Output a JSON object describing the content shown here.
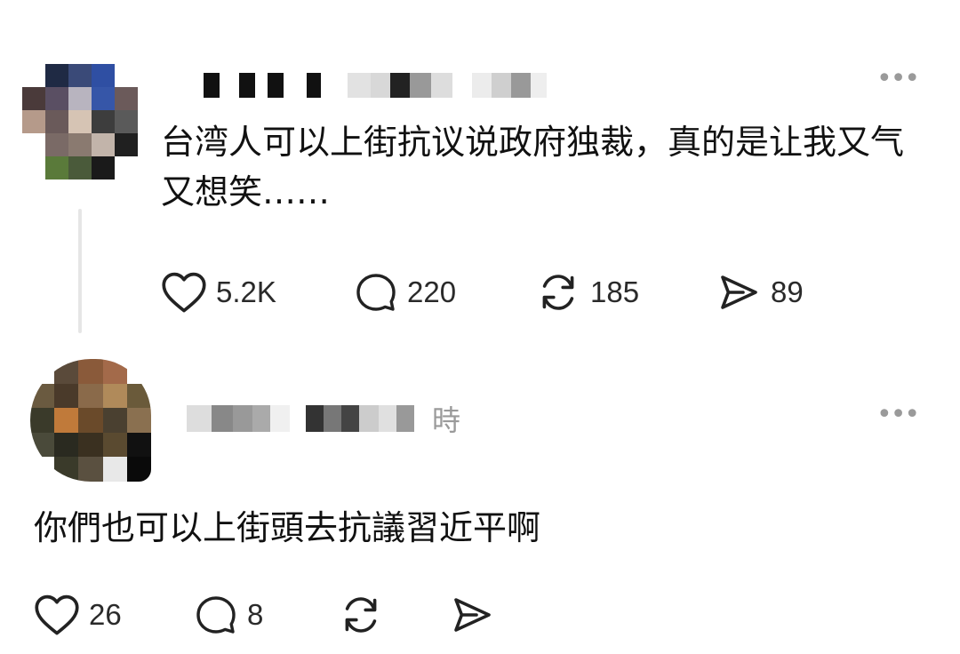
{
  "post": {
    "text": "台湾人可以上街抗议说政府独裁，真的是让我又气又想笑……",
    "likes": "5.2K",
    "comments": "220",
    "reposts": "185",
    "shares": "89"
  },
  "reply": {
    "time_suffix": "時",
    "text": "你們也可以上街頭去抗議習近平啊",
    "likes": "26",
    "comments": "8"
  },
  "icons": {
    "like": "heart-icon",
    "comment": "speech-bubble-icon",
    "repost": "repost-icon",
    "share": "send-icon",
    "more": "more-horizontal-icon"
  },
  "colors": {
    "text": "#111111",
    "muted": "#9a9a9a",
    "thread_line": "#e6e6e6"
  }
}
